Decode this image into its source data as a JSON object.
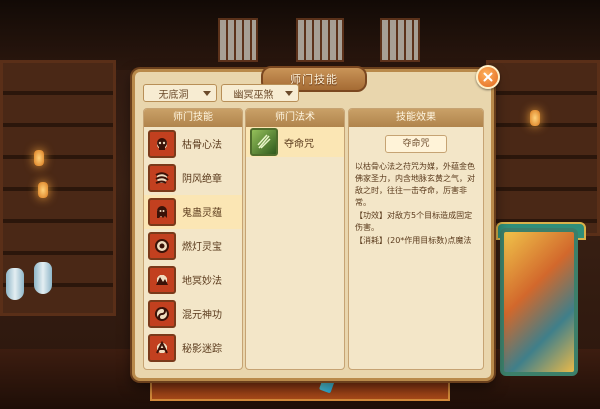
{
  "window": {
    "title": "师门技能"
  },
  "filters": {
    "school": "无底洞",
    "category": "幽冥巫煞"
  },
  "skills_panel": {
    "header": "师门技能",
    "items": [
      {
        "label": "枯骨心法",
        "icon": "skull-icon",
        "selected": false
      },
      {
        "label": "阴风绝章",
        "icon": "wind-icon",
        "selected": false
      },
      {
        "label": "鬼蛊灵蕴",
        "icon": "ghost-icon",
        "selected": true
      },
      {
        "label": "燃灯灵宝",
        "icon": "lamp-icon",
        "selected": false
      },
      {
        "label": "地冥妙法",
        "icon": "earth-icon",
        "selected": false
      },
      {
        "label": "混元神功",
        "icon": "chaos-icon",
        "selected": false
      },
      {
        "label": "秘影迷踪",
        "icon": "shadow-icon",
        "selected": false
      }
    ]
  },
  "spells_panel": {
    "header": "师门法术",
    "items": [
      {
        "label": "夺命咒",
        "icon": "claw-icon"
      }
    ]
  },
  "effect_panel": {
    "header": "技能效果",
    "spell_name": "夺命咒",
    "description": "以枯骨心法之苻咒为媒，外蕴金色佛家圣力，内含地脉玄黄之气，对敌之时，往往一击夺命，厉害非常。",
    "effect": "【功效】对敌方5个目标造成固定伤害。",
    "cost": "【消耗】(20*作用目标数)点魔法"
  },
  "colors": {
    "panel_bg": "#e9d6ad",
    "header_brown": "#b0844c",
    "selected_row": "#fbe6b4",
    "close_orange": "#e0661f"
  }
}
